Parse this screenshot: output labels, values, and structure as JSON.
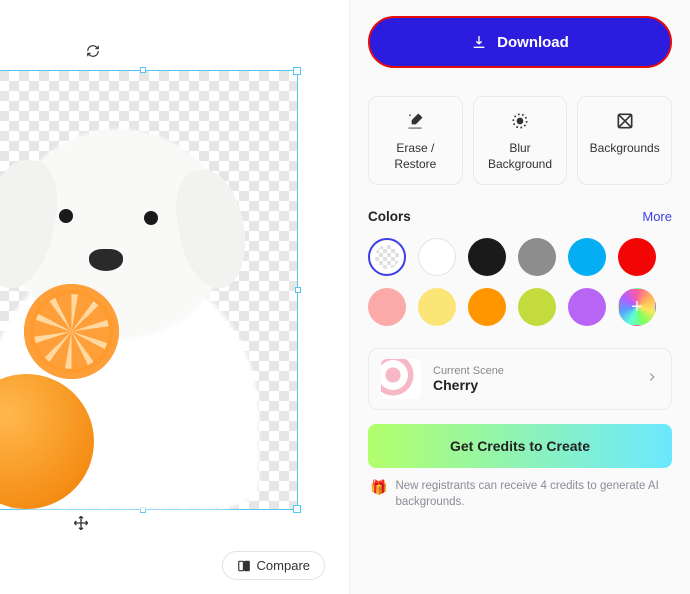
{
  "download": {
    "label": "Download"
  },
  "tools": {
    "erase": {
      "label": "Erase / Restore"
    },
    "blur": {
      "label": "Blur Background"
    },
    "backgrounds": {
      "label": "Backgrounds"
    }
  },
  "colors": {
    "title": "Colors",
    "more": "More",
    "swatches": [
      {
        "name": "transparent",
        "value": "transparent",
        "selected": true,
        "special": "transparent"
      },
      {
        "name": "white",
        "value": "#ffffff",
        "special": "white"
      },
      {
        "name": "black",
        "value": "#1a1a1a"
      },
      {
        "name": "gray",
        "value": "#8d8d8d"
      },
      {
        "name": "cyan",
        "value": "#05aef2"
      },
      {
        "name": "red",
        "value": "#f20505"
      },
      {
        "name": "pink",
        "value": "#fca9a9"
      },
      {
        "name": "yellow",
        "value": "#fce577"
      },
      {
        "name": "orange",
        "value": "#ff9600"
      },
      {
        "name": "lime",
        "value": "#c4db3e"
      },
      {
        "name": "purple",
        "value": "#b864f5"
      },
      {
        "name": "custom",
        "value": "rainbow",
        "special": "rainbow"
      }
    ]
  },
  "scene": {
    "label": "Current Scene",
    "value": "Cherry"
  },
  "credits": {
    "button": "Get Credits to Create",
    "note": "New registrants can receive 4 credits to generate AI backgrounds."
  },
  "compare": {
    "label": "Compare"
  }
}
